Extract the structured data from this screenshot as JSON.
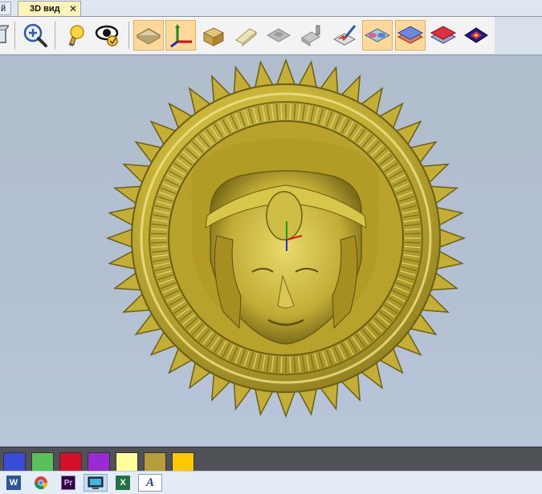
{
  "tabs": {
    "prev_label": "й",
    "active_label": "3D вид",
    "close_glyph": "✕"
  },
  "toolbar": {
    "buttons": [
      {
        "icon": "cube-view-icon",
        "active": false
      },
      {
        "icon": "zoom-in-icon",
        "active": false
      },
      {
        "icon": "lightbulb-icon",
        "active": false
      },
      {
        "icon": "eye-icon",
        "active": false
      },
      {
        "icon": "plane-icon",
        "active": true
      },
      {
        "icon": "axes-icon",
        "active": true
      },
      {
        "icon": "material-block-icon",
        "active": false
      },
      {
        "icon": "toolpath-icon",
        "active": false
      },
      {
        "icon": "relief-icon",
        "active": false
      },
      {
        "icon": "tool-icon",
        "active": false
      },
      {
        "icon": "paint-brush-icon",
        "active": false
      },
      {
        "icon": "layers-colored-icon",
        "active": true
      },
      {
        "icon": "layer-stack-icon",
        "active": true
      },
      {
        "icon": "red-layer-icon",
        "active": false
      },
      {
        "icon": "heightmap-icon",
        "active": false
      }
    ]
  },
  "colors": {
    "swatches": [
      "#3a4ad9",
      "#58c158",
      "#d4102a",
      "#9a2ad6",
      "#ffff99",
      "#b59e3a",
      "#ffc800"
    ],
    "relief_gold": "#c9b438"
  },
  "taskbar": {
    "apps": [
      {
        "icon": "word-icon",
        "label": "W"
      },
      {
        "icon": "chrome-icon",
        "label": ""
      },
      {
        "icon": "premiere-icon",
        "label": "Pr"
      },
      {
        "icon": "monitor-app-icon",
        "label": ""
      },
      {
        "icon": "excel-icon",
        "label": "X"
      },
      {
        "icon": "artcam-icon",
        "label": "A"
      }
    ]
  }
}
